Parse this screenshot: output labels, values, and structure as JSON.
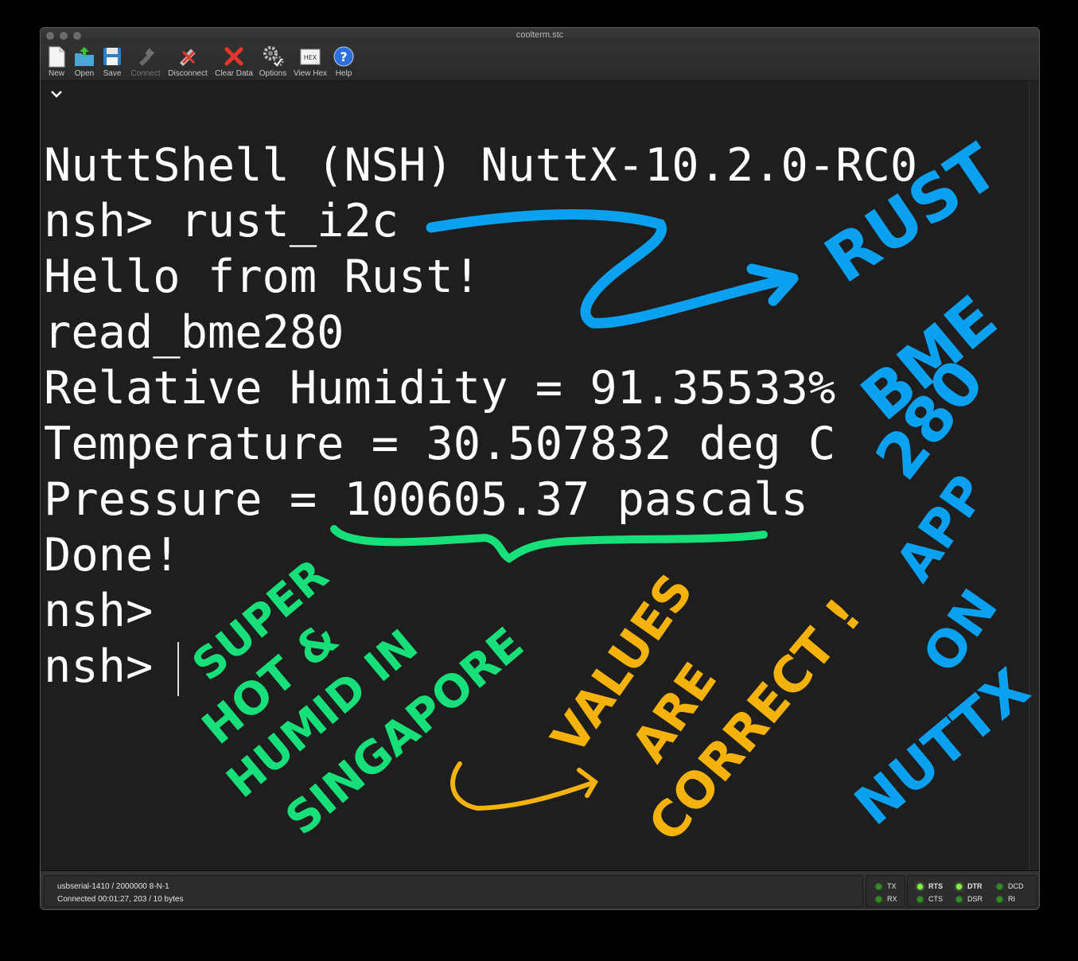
{
  "window": {
    "title": "coolterm.stc"
  },
  "toolbar": {
    "new_label": "New",
    "open_label": "Open",
    "save_label": "Save",
    "connect_label": "Connect",
    "disconnect_label": "Disconnect",
    "clear_label": "Clear Data",
    "options_label": "Options",
    "viewhex_label": "View Hex",
    "viewhex_icon_text": "HEX",
    "help_label": "Help"
  },
  "terminal": {
    "lines": [
      "NuttShell (NSH) NuttX-10.2.0-RC0",
      "nsh> rust_i2c",
      "Hello from Rust!",
      "read_bme280",
      "Relative Humidity = 91.35533%",
      "Temperature = 30.507832 deg C",
      "Pressure = 100605.37 pascals",
      "Done!",
      "nsh>",
      "nsh> "
    ]
  },
  "status": {
    "port_settings": "usbserial-1410 / 2000000 8-N-1",
    "connection": "Connected 00:01:27, 203 / 10 bytes",
    "indicators": {
      "tx": "TX",
      "rx": "RX",
      "rts": "RTS",
      "cts": "CTS",
      "dtr": "DTR",
      "dsr": "DSR",
      "dcd": "DCD",
      "ri": "RI"
    }
  },
  "annotations": {
    "rust": "RUST",
    "bme_a": "BME",
    "bme_b": "280",
    "app": "APP",
    "on": "ON",
    "nuttx": "NUTTX",
    "super": "SUPER",
    "hot": "HOT &",
    "humid": "HUMID IN",
    "singapore": "SINGAPORE",
    "values": "VALUES",
    "are": "ARE",
    "correct": "CORRECT !",
    "colors": {
      "blue": "#0aa2f0",
      "green": "#17e07a",
      "yellow": "#f5b20a"
    }
  }
}
